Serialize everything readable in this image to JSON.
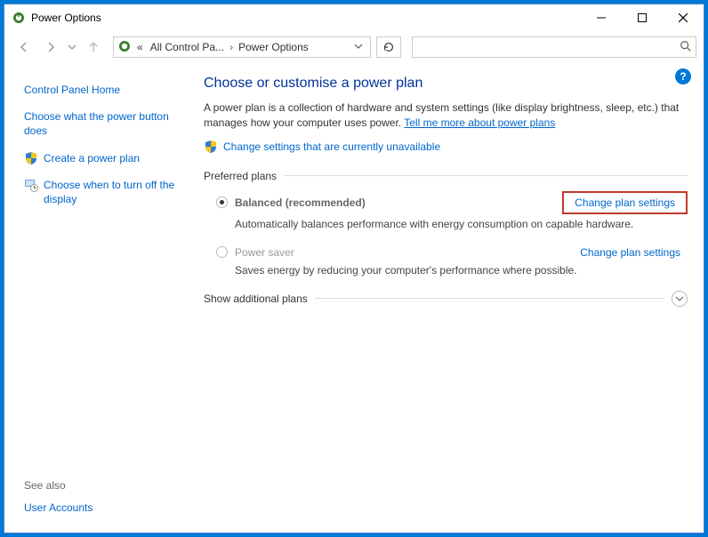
{
  "titlebar": {
    "title": "Power Options"
  },
  "nav": {
    "crumb_prefix": "«",
    "crumb1": "All Control Pa...",
    "crumb2": "Power Options"
  },
  "sidebar": {
    "home": "Control Panel Home",
    "choose_button": "Choose what the power button does",
    "create_plan": "Create a power plan",
    "choose_off": "Choose when to turn off the display",
    "see_also": "See also",
    "user_accounts": "User Accounts"
  },
  "main": {
    "heading": "Choose or customise a power plan",
    "desc_pre": "A power plan is a collection of hardware and system settings (like display brightness, sleep, etc.) that manages how your computer uses power. ",
    "desc_link": "Tell me more about power plans",
    "elev_link": "Change settings that are currently unavailable",
    "preferred_label": "Preferred plans",
    "plans": [
      {
        "name": "Balanced (recommended)",
        "desc": "Automatically balances performance with energy consumption on capable hardware.",
        "change": "Change plan settings",
        "selected": true,
        "highlighted": true
      },
      {
        "name": "Power saver",
        "desc": "Saves energy by reducing your computer's performance where possible.",
        "change": "Change plan settings",
        "selected": false,
        "highlighted": false
      }
    ],
    "show_additional": "Show additional plans"
  }
}
